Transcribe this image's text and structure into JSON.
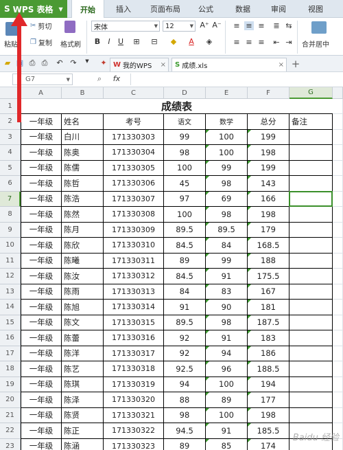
{
  "app": {
    "name": "WPS 表格"
  },
  "menu": [
    "开始",
    "插入",
    "页面布局",
    "公式",
    "数据",
    "审阅",
    "视图"
  ],
  "ribbon": {
    "paste": "粘贴",
    "cut": "剪切",
    "copy": "复制",
    "format_painter": "格式刷",
    "font_name": "宋体",
    "font_size": "12",
    "merge_center": "合并居中"
  },
  "doc_tabs": [
    {
      "label": "我的WPS"
    },
    {
      "label": "成绩.xls"
    }
  ],
  "formula_bar": {
    "name_box": "G7",
    "fx": "fx",
    "content": ""
  },
  "sheet": {
    "columns": [
      "A",
      "B",
      "C",
      "D",
      "E",
      "F",
      "G"
    ],
    "selected_cell": "G7",
    "title": "成绩表",
    "headers": [
      "一年级",
      "姓名",
      "考号",
      "语文",
      "数学",
      "总分",
      "备注"
    ],
    "rows": [
      [
        "一年级",
        "白川",
        "171330303",
        "99",
        "100",
        "199"
      ],
      [
        "一年级",
        "陈奥",
        "171330304",
        "98",
        "100",
        "198"
      ],
      [
        "一年级",
        "陈儒",
        "171330305",
        "100",
        "99",
        "199"
      ],
      [
        "一年级",
        "陈哲",
        "171330306",
        "45",
        "98",
        "143"
      ],
      [
        "一年级",
        "陈浩",
        "171330307",
        "97",
        "69",
        "166"
      ],
      [
        "一年级",
        "陈然",
        "171330308",
        "100",
        "98",
        "198"
      ],
      [
        "一年级",
        "陈月",
        "171330309",
        "89.5",
        "89.5",
        "179"
      ],
      [
        "一年级",
        "陈欣",
        "171330310",
        "84.5",
        "84",
        "168.5"
      ],
      [
        "一年级",
        "陈曦",
        "171330311",
        "89",
        "99",
        "188"
      ],
      [
        "一年级",
        "陈汝",
        "171330312",
        "84.5",
        "91",
        "175.5"
      ],
      [
        "一年级",
        "陈雨",
        "171330313",
        "84",
        "83",
        "167"
      ],
      [
        "一年级",
        "陈旭",
        "171330314",
        "91",
        "90",
        "181"
      ],
      [
        "一年级",
        "陈文",
        "171330315",
        "89.5",
        "98",
        "187.5"
      ],
      [
        "一年级",
        "陈蕾",
        "171330316",
        "92",
        "91",
        "183"
      ],
      [
        "一年级",
        "陈洋",
        "171330317",
        "92",
        "94",
        "186"
      ],
      [
        "一年级",
        "陈艺",
        "171330318",
        "92.5",
        "96",
        "188.5"
      ],
      [
        "一年级",
        "陈琪",
        "171330319",
        "94",
        "100",
        "194"
      ],
      [
        "一年级",
        "陈泽",
        "171330320",
        "88",
        "89",
        "177"
      ],
      [
        "一年级",
        "陈贤",
        "171330321",
        "98",
        "100",
        "198"
      ],
      [
        "一年级",
        "陈正",
        "171330322",
        "94.5",
        "91",
        "185.5"
      ],
      [
        "一年级",
        "陈涵",
        "171330323",
        "89",
        "85",
        "174"
      ]
    ]
  },
  "watermark": "Baidu 经验"
}
